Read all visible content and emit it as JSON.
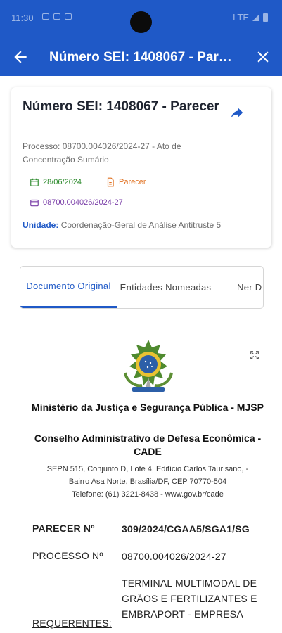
{
  "status_bar": {
    "time": "11:30",
    "network": "LTE"
  },
  "app_bar": {
    "title": "Número SEI: 1408067 - Parecer",
    "back_icon": "arrow-left-icon",
    "close_icon": "close-icon",
    "color": "#1f59c7"
  },
  "card": {
    "title": "Número SEI: 1408067 - Parecer",
    "share_icon": "share-icon",
    "process": "Processo: 08700.004026/2024-27 - Ato de Concentração Sumário",
    "date": "28/06/2024",
    "doc_type": "Parecer",
    "process_number": "08700.004026/2024-27",
    "unit_label": "Unidade:",
    "unit_value": "Coordenação-Geral de Análise Antitruste 5",
    "colors": {
      "date": "#2e8b2e",
      "type": "#e07020",
      "number": "#7a3ea8"
    }
  },
  "tabs": [
    {
      "label": "Documento Original",
      "active": true
    },
    {
      "label": "Entidades Nomeadas",
      "active": false
    },
    {
      "label": "Ner D",
      "active": false
    }
  ],
  "document": {
    "expand_icon": "expand-icon",
    "org_line1": "Ministério da Justiça e Segurança Pública - MJSP",
    "org_line2": "Conselho Administrativo de Defesa Econômica - CADE",
    "address_line1": "SEPN 515, Conjunto D, Lote 4, Edifício Carlos Taurisano, -",
    "address_line2": "Bairro Asa Norte, Brasília/DF, CEP 70770-504",
    "address_line3": "Telefone: (61) 3221-8438 - www.gov.br/cade",
    "rows": [
      {
        "label": "PARECER Nº",
        "value": "309/2024/CGAA5/SGA1/SG"
      },
      {
        "label": "PROCESSO Nº",
        "value": "08700.004026/2024-27"
      },
      {
        "label": "REQUERENTES:",
        "value": "TERMINAL MULTIMODAL DE GRÃOS E FERTILIZANTES E EMBRAPORT - EMPRESA"
      }
    ]
  }
}
